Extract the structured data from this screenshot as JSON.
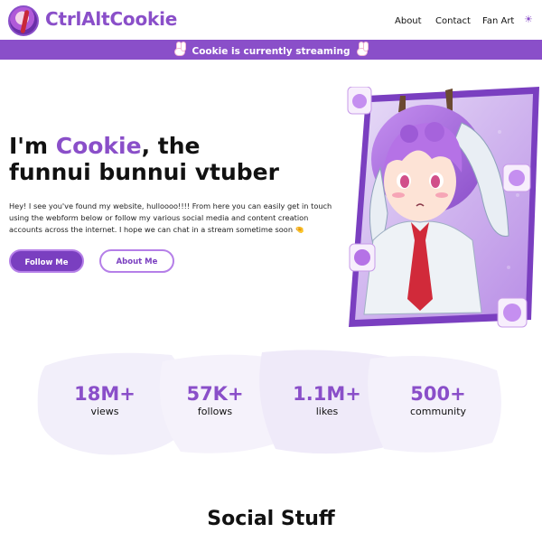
{
  "header": {
    "logo_text": "CtrlAltCookie",
    "nav": [
      "About",
      "Contact",
      "Fan Art"
    ],
    "theme_icon": "sun-icon"
  },
  "banner": {
    "text": "Cookie is currently streaming",
    "icon": "bunny-icon"
  },
  "hero": {
    "title_prefix": "I'm ",
    "title_accent": "Cookie",
    "title_suffix_1": ", the",
    "title_line_2": "funnui bunnui vtuber",
    "body": "Hey! I see you've found my website, hulloooo!!!! From here you can easily get in touch using the webform below or follow my various social media and content creation accounts across the internet. I hope we can chat in a stream sometime soon 🤏",
    "follow_label": "Follow Me",
    "about_label": "About Me"
  },
  "stats": [
    {
      "value": "18M+",
      "label": "views"
    },
    {
      "value": "57K+",
      "label": "follows"
    },
    {
      "value": "1.1M+",
      "label": "likes"
    },
    {
      "value": "500+",
      "label": "community"
    }
  ],
  "social": {
    "title": "Social Stuff"
  },
  "colors": {
    "accent": "#8a4fc9",
    "accent_dark": "#7a3fc0",
    "blob": "#f2effa"
  }
}
